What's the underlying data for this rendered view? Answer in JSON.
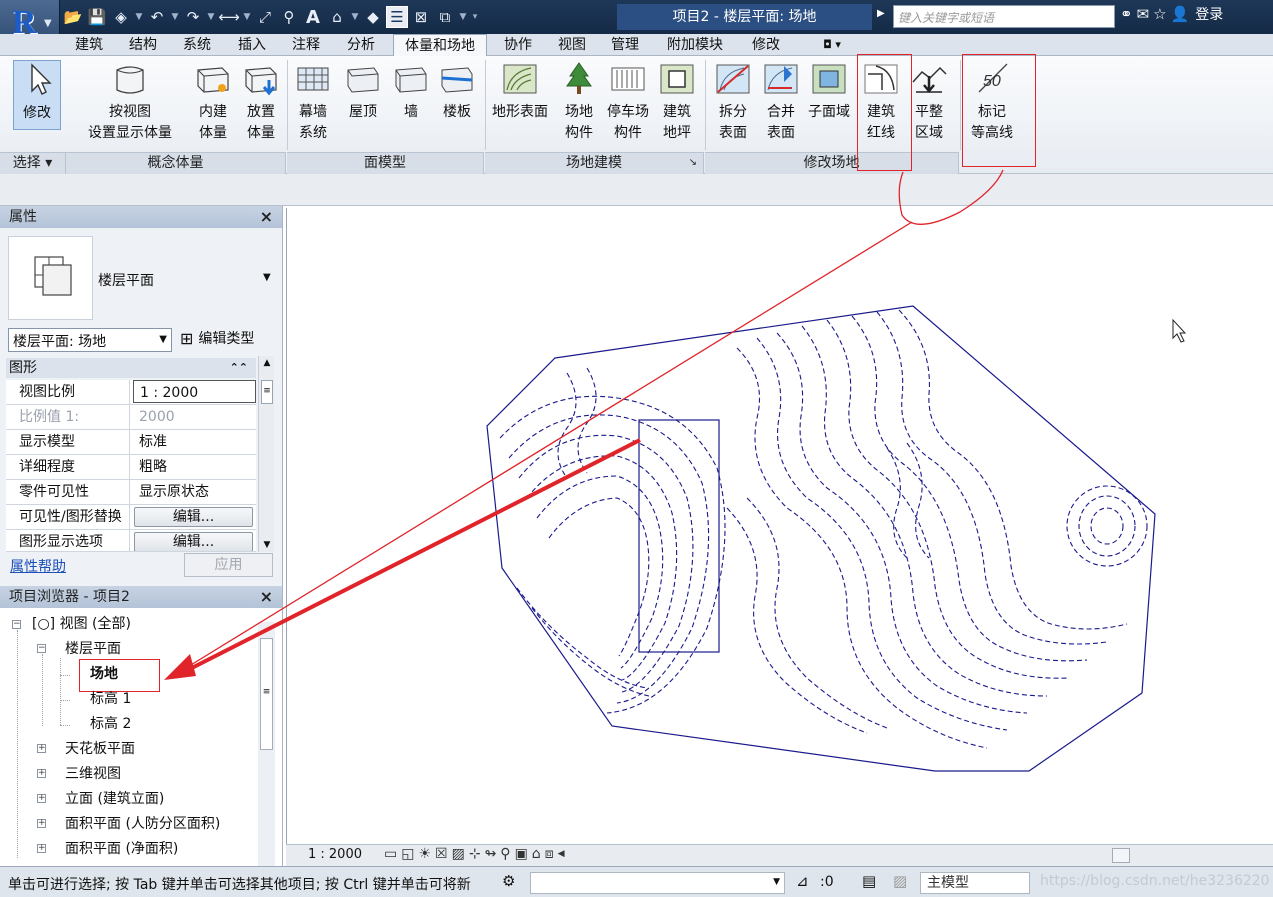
{
  "app": {
    "window_title": "项目2 - 楼层平面: 场地",
    "search_placeholder": "键入关键字或短语",
    "login_label": "登录"
  },
  "ribbon_tabs": [
    "建筑",
    "结构",
    "系统",
    "插入",
    "注释",
    "分析",
    "体量和场地",
    "协作",
    "视图",
    "管理",
    "附加模块",
    "修改"
  ],
  "ribbon": {
    "modify": "修改",
    "select_panel": "选择",
    "massing": {
      "show_mass_line1": "按视图",
      "show_mass_line2": "设置显示体量",
      "inplace_mass_line1": "内建",
      "inplace_mass_line2": "体量",
      "place_mass_line1": "放置",
      "place_mass_line2": "体量",
      "panel": "概念体量"
    },
    "face_model": {
      "curtain_line1": "幕墙",
      "curtain_line2": "系统",
      "roof": "屋顶",
      "wall": "墙",
      "floor": "楼板",
      "panel": "面模型"
    },
    "site_model": {
      "toposurface": "地形表面",
      "site_comp_line1": "场地",
      "site_comp_line2": "构件",
      "parking_line1": "停车场",
      "parking_line2": "构件",
      "pad_line1": "建筑",
      "pad_line2": "地坪",
      "panel": "场地建模"
    },
    "modify_site": {
      "split_line1": "拆分",
      "split_line2": "表面",
      "merge_line1": "合并",
      "merge_line2": "表面",
      "subregion": "子面域",
      "property_line_line1": "建筑",
      "property_line_line2": "红线",
      "graded_line1": "平整",
      "graded_line2": "区域",
      "label_line1": "标记",
      "label_line2": "等高线",
      "panel": "修改场地",
      "label_icon_value": "50"
    }
  },
  "properties": {
    "title": "属性",
    "type_name": "楼层平面",
    "instance_selector": "楼层平面: 场地",
    "edit_type": "编辑类型",
    "group": "图形",
    "rows": [
      {
        "key": "视图比例",
        "value": "1 : 2000"
      },
      {
        "key": "比例值 1:",
        "value": "2000"
      },
      {
        "key": "显示模型",
        "value": "标准"
      },
      {
        "key": "详细程度",
        "value": "粗略"
      },
      {
        "key": "零件可见性",
        "value": "显示原状态"
      },
      {
        "key": "可见性/图形替换",
        "value": "编辑..."
      },
      {
        "key": "图形显示选项",
        "value": "编辑..."
      }
    ],
    "help_link": "属性帮助",
    "apply": "应用"
  },
  "browser": {
    "title": "项目浏览器 - 项目2",
    "views_all": "视图 (全部)",
    "floor_plans": "楼层平面",
    "site": "场地",
    "level1": "标高 1",
    "level2": "标高 2",
    "ceiling_plans": "天花板平面",
    "views_3d": "三维视图",
    "elevations": "立面 (建筑立面)",
    "area_plan_civil": "面积平面 (人防分区面积)",
    "area_plan_net": "面积平面 (净面积)"
  },
  "viewbar": {
    "scale": "1 : 2000"
  },
  "status": {
    "message": "单击可进行选择; 按 Tab 键并单击可选择其他项目; 按 Ctrl 键并单击可将新",
    "selection_count": ":0",
    "model": "主模型",
    "watermark": "https://blog.csdn.net/he3236220"
  },
  "colors": {
    "accent_red": "#e0242a",
    "contour_blue": "#1a1a8c"
  }
}
